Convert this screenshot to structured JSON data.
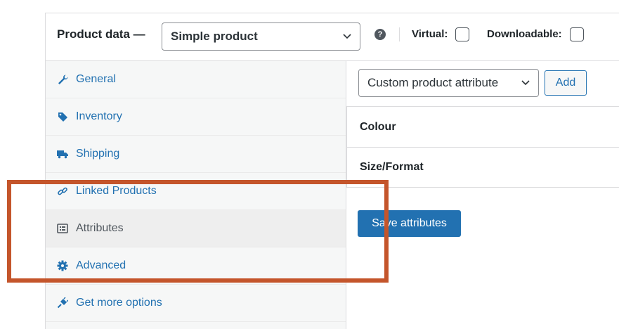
{
  "product_data": {
    "title": "Product data —",
    "type_select": {
      "value": "Simple product"
    },
    "help_icon": "?",
    "virtual_label": "Virtual:",
    "virtual_checked": false,
    "downloadable_label": "Downloadable:",
    "downloadable_checked": false
  },
  "tabs": [
    {
      "label": "General",
      "icon": "wrench-icon"
    },
    {
      "label": "Inventory",
      "icon": "tag-icon"
    },
    {
      "label": "Shipping",
      "icon": "truck-icon"
    },
    {
      "label": "Linked Products",
      "icon": "link-icon"
    },
    {
      "label": "Attributes",
      "icon": "list-icon",
      "active": true
    },
    {
      "label": "Advanced",
      "icon": "gear-icon"
    },
    {
      "label": "Get more options",
      "icon": "plugin-icon"
    }
  ],
  "attributes_panel": {
    "attribute_select": {
      "value": "Custom product attribute"
    },
    "add_label": "Add",
    "attributes": [
      "Colour",
      "Size/Format"
    ],
    "save_label": "Save attributes"
  },
  "colors": {
    "link": "#2271b1",
    "highlight": "#c4552b",
    "primary_button": "#2271b1"
  }
}
